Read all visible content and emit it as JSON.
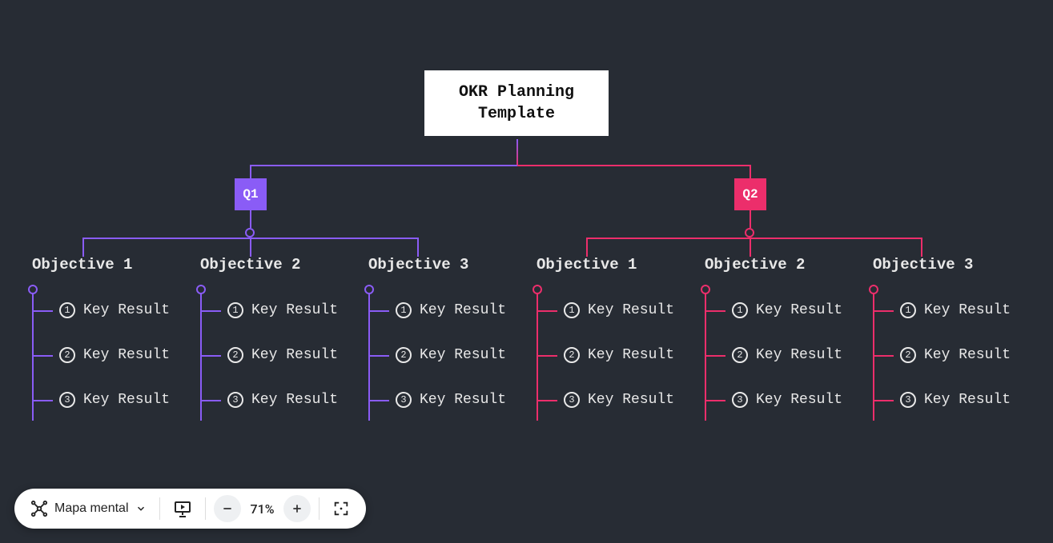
{
  "root": {
    "title": "OKR Planning Template"
  },
  "quarters": [
    {
      "id": "q1",
      "label": "Q1",
      "color": "#8a5cf6",
      "objectives": [
        {
          "title": "Objective 1",
          "keyResults": [
            "Key Result",
            "Key Result",
            "Key Result"
          ]
        },
        {
          "title": "Objective 2",
          "keyResults": [
            "Key Result",
            "Key Result",
            "Key Result"
          ]
        },
        {
          "title": "Objective 3",
          "keyResults": [
            "Key Result",
            "Key Result",
            "Key Result"
          ]
        }
      ]
    },
    {
      "id": "q2",
      "label": "Q2",
      "color": "#ec2e6b",
      "objectives": [
        {
          "title": "Objective 1",
          "keyResults": [
            "Key Result",
            "Key Result",
            "Key Result"
          ]
        },
        {
          "title": "Objective 2",
          "keyResults": [
            "Key Result",
            "Key Result",
            "Key Result"
          ]
        },
        {
          "title": "Objective 3",
          "keyResults": [
            "Key Result",
            "Key Result",
            "Key Result"
          ]
        }
      ]
    }
  ],
  "toolbar": {
    "mode_label": "Mapa mental",
    "zoom_pct": "71%"
  },
  "colors": {
    "bg": "#272c34",
    "q1": "#8a5cf6",
    "q2": "#ec2e6b"
  }
}
